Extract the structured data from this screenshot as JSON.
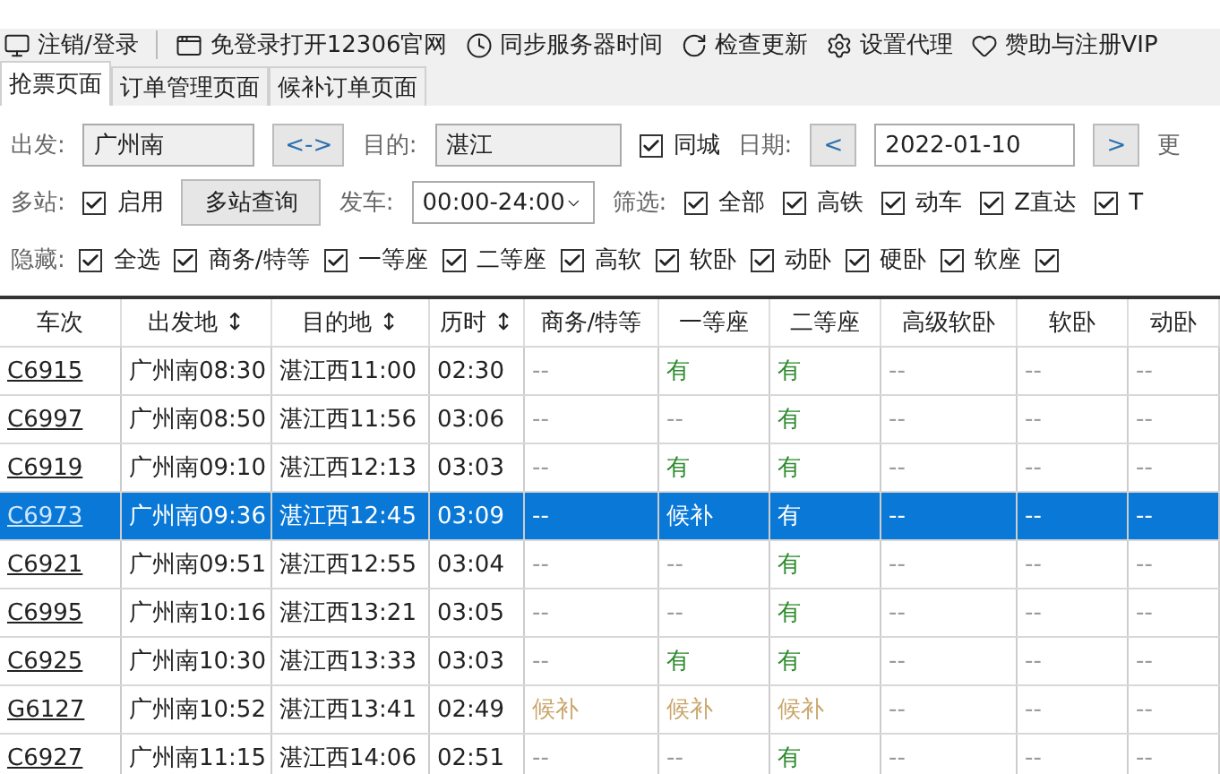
{
  "toolbar": [
    {
      "label": "注销/登录"
    },
    {
      "label": "免登录打开12306官网"
    },
    {
      "label": "同步服务器时间"
    },
    {
      "label": "检查更新"
    },
    {
      "label": "设置代理"
    },
    {
      "label": "赞助与注册VIP"
    }
  ],
  "tabs": [
    {
      "label": "抢票页面",
      "selected": true
    },
    {
      "label": "订单管理页面",
      "selected": false
    },
    {
      "label": "候补订单页面",
      "selected": false
    }
  ],
  "form": {
    "from_label": "出发:",
    "from_value": "广州南",
    "swap_button": "<->",
    "to_label": "目的:",
    "to_value": "湛江",
    "same_city": {
      "label": "同城",
      "checked": true
    },
    "date_label": "日期:",
    "date_prev": "<",
    "date_value": "2022-01-10",
    "date_next": ">",
    "more": "更",
    "multi_label": "多站:",
    "multi_enable": {
      "label": "启用",
      "checked": true
    },
    "multi_button": "多站查询",
    "depart_label": "发车:",
    "depart_value": "00:00-24:00",
    "filter_label": "筛选:",
    "filters": [
      {
        "label": "全部",
        "checked": true
      },
      {
        "label": "高铁",
        "checked": true
      },
      {
        "label": "动车",
        "checked": true
      },
      {
        "label": "Z直达",
        "checked": true
      },
      {
        "label": "T",
        "checked": true
      }
    ],
    "hide_label": "隐藏:",
    "hides": [
      {
        "label": "全选",
        "checked": true
      },
      {
        "label": "商务/特等",
        "checked": true
      },
      {
        "label": "一等座",
        "checked": true
      },
      {
        "label": "二等座",
        "checked": true
      },
      {
        "label": "高软",
        "checked": true
      },
      {
        "label": "软卧",
        "checked": true
      },
      {
        "label": "动卧",
        "checked": true
      },
      {
        "label": "硬卧",
        "checked": true
      },
      {
        "label": "软座",
        "checked": true
      },
      {
        "checked": true
      }
    ]
  },
  "table": {
    "columns": [
      "车次",
      "出发地 ↕",
      "目的地 ↕",
      "历时 ↕",
      "商务/特等",
      "一等座",
      "二等座",
      "高级软卧",
      "软卧",
      "动卧"
    ],
    "rows": [
      {
        "train": "C6915",
        "from": "广州南08:30",
        "to": "湛江西11:00",
        "duration": "02:30",
        "selected": false,
        "seats": [
          {
            "text": "--",
            "kind": "none"
          },
          {
            "text": "有",
            "kind": "available"
          },
          {
            "text": "有",
            "kind": "available"
          },
          {
            "text": "--",
            "kind": "none"
          },
          {
            "text": "--",
            "kind": "none"
          },
          {
            "text": "--",
            "kind": "none"
          }
        ]
      },
      {
        "train": "C6997",
        "from": "广州南08:50",
        "to": "湛江西11:56",
        "duration": "03:06",
        "selected": false,
        "seats": [
          {
            "text": "--",
            "kind": "none"
          },
          {
            "text": "--",
            "kind": "none"
          },
          {
            "text": "有",
            "kind": "available"
          },
          {
            "text": "--",
            "kind": "none"
          },
          {
            "text": "--",
            "kind": "none"
          },
          {
            "text": "--",
            "kind": "none"
          }
        ]
      },
      {
        "train": "C6919",
        "from": "广州南09:10",
        "to": "湛江西12:13",
        "duration": "03:03",
        "selected": false,
        "seats": [
          {
            "text": "--",
            "kind": "none"
          },
          {
            "text": "有",
            "kind": "available"
          },
          {
            "text": "有",
            "kind": "available"
          },
          {
            "text": "--",
            "kind": "none"
          },
          {
            "text": "--",
            "kind": "none"
          },
          {
            "text": "--",
            "kind": "none"
          }
        ]
      },
      {
        "train": "C6973",
        "from": "广州南09:36",
        "to": "湛江西12:45",
        "duration": "03:09",
        "selected": true,
        "seats": [
          {
            "text": "--",
            "kind": "none"
          },
          {
            "text": "候补",
            "kind": "waitlist"
          },
          {
            "text": "有",
            "kind": "available"
          },
          {
            "text": "--",
            "kind": "none"
          },
          {
            "text": "--",
            "kind": "none"
          },
          {
            "text": "--",
            "kind": "none"
          }
        ]
      },
      {
        "train": "C6921",
        "from": "广州南09:51",
        "to": "湛江西12:55",
        "duration": "03:04",
        "selected": false,
        "seats": [
          {
            "text": "--",
            "kind": "none"
          },
          {
            "text": "--",
            "kind": "none"
          },
          {
            "text": "有",
            "kind": "available"
          },
          {
            "text": "--",
            "kind": "none"
          },
          {
            "text": "--",
            "kind": "none"
          },
          {
            "text": "--",
            "kind": "none"
          }
        ]
      },
      {
        "train": "C6995",
        "from": "广州南10:16",
        "to": "湛江西13:21",
        "duration": "03:05",
        "selected": false,
        "seats": [
          {
            "text": "--",
            "kind": "none"
          },
          {
            "text": "--",
            "kind": "none"
          },
          {
            "text": "有",
            "kind": "available"
          },
          {
            "text": "--",
            "kind": "none"
          },
          {
            "text": "--",
            "kind": "none"
          },
          {
            "text": "--",
            "kind": "none"
          }
        ]
      },
      {
        "train": "C6925",
        "from": "广州南10:30",
        "to": "湛江西13:33",
        "duration": "03:03",
        "selected": false,
        "seats": [
          {
            "text": "--",
            "kind": "none"
          },
          {
            "text": "有",
            "kind": "available"
          },
          {
            "text": "有",
            "kind": "available"
          },
          {
            "text": "--",
            "kind": "none"
          },
          {
            "text": "--",
            "kind": "none"
          },
          {
            "text": "--",
            "kind": "none"
          }
        ]
      },
      {
        "train": "G6127",
        "from": "广州南10:52",
        "to": "湛江西13:41",
        "duration": "02:49",
        "selected": false,
        "seats": [
          {
            "text": "候补",
            "kind": "waitlist"
          },
          {
            "text": "候补",
            "kind": "waitlist"
          },
          {
            "text": "候补",
            "kind": "waitlist"
          },
          {
            "text": "--",
            "kind": "none"
          },
          {
            "text": "--",
            "kind": "none"
          },
          {
            "text": "--",
            "kind": "none"
          }
        ]
      },
      {
        "train": "C6927",
        "from": "广州南11:15",
        "to": "湛江西14:06",
        "duration": "02:51",
        "selected": false,
        "seats": [
          {
            "text": "--",
            "kind": "none"
          },
          {
            "text": "--",
            "kind": "none"
          },
          {
            "text": "有",
            "kind": "available"
          },
          {
            "text": "--",
            "kind": "none"
          },
          {
            "text": "--",
            "kind": "none"
          },
          {
            "text": "--",
            "kind": "none"
          }
        ]
      }
    ]
  }
}
